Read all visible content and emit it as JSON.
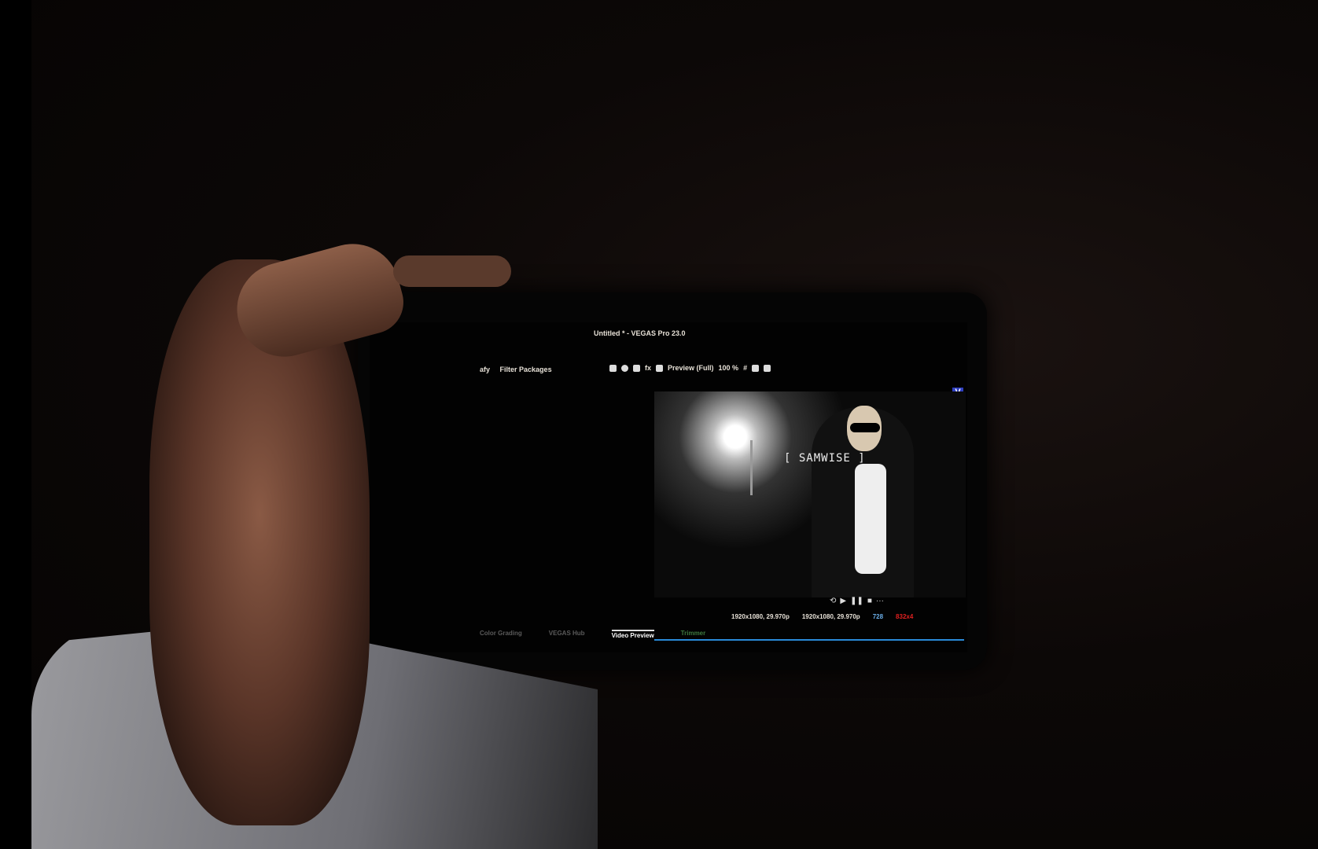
{
  "window": {
    "title": "Untitled * - VEGAS Pro 23.0"
  },
  "toolbar": {
    "left_partial": "afy",
    "filter_packages": "Filter Packages",
    "preview_quality": "Preview (Full)",
    "zoom": "100 %"
  },
  "preview": {
    "overlay_text": "[ SAMWISE ]",
    "badge": "V"
  },
  "transport": {
    "loop": "⟲",
    "play": "▶",
    "pause": "❚❚",
    "stop": "■",
    "more": "···"
  },
  "status": {
    "project_format": "1920x1080, 29.970p",
    "preview_format": "1920x1080, 29.970p",
    "display_size": "728",
    "dropped": "832x4"
  },
  "tabs": [
    "Color Grading",
    "VEGAS Hub",
    "Video Preview",
    "Trimmer"
  ],
  "colors": {
    "accent": "#2a8ad8",
    "warning": "#e02020"
  }
}
